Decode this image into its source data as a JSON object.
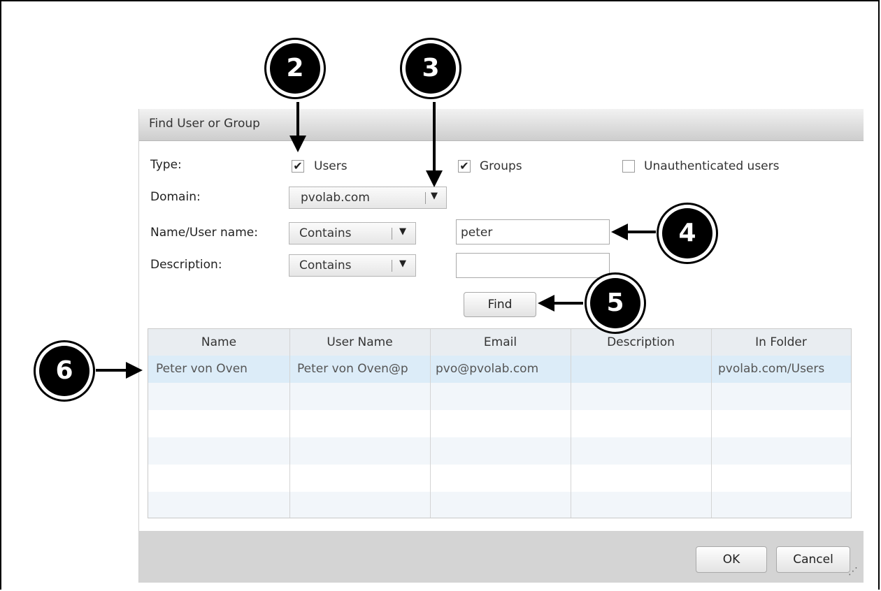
{
  "dialog": {
    "title": "Find User or Group",
    "type_label": "Type:",
    "domain_label": "Domain:",
    "name_label": "Name/User name:",
    "description_label": "Description:",
    "checkboxes": [
      {
        "label": "Users",
        "checked": true,
        "mark": "✔"
      },
      {
        "label": "Groups",
        "checked": true,
        "mark": "✔"
      },
      {
        "label": "Unauthenticated users",
        "checked": false,
        "mark": ""
      }
    ],
    "domain_value": "pvolab.com",
    "name_match": "Contains",
    "name_value": "peter",
    "description_match": "Contains",
    "description_value": "",
    "find_button": "Find",
    "dropdown_glyph": "▼",
    "ok_button": "OK",
    "cancel_button": "Cancel",
    "grip_glyph": "⋰"
  },
  "results": {
    "columns": [
      "Name",
      "User Name",
      "Email",
      "Description",
      "In Folder"
    ],
    "rows": [
      [
        "Peter von Oven",
        "Peter von Oven@p",
        "pvo@pvolab.com",
        "",
        "pvolab.com/Users"
      ]
    ]
  },
  "callouts": [
    "2",
    "3",
    "4",
    "5",
    "6"
  ],
  "colors": {
    "selected_row": "#dcecf8",
    "alt_row": "#f2f6fa",
    "header_bg": "#e9edf1",
    "footer_bg": "#d4d4d4"
  }
}
